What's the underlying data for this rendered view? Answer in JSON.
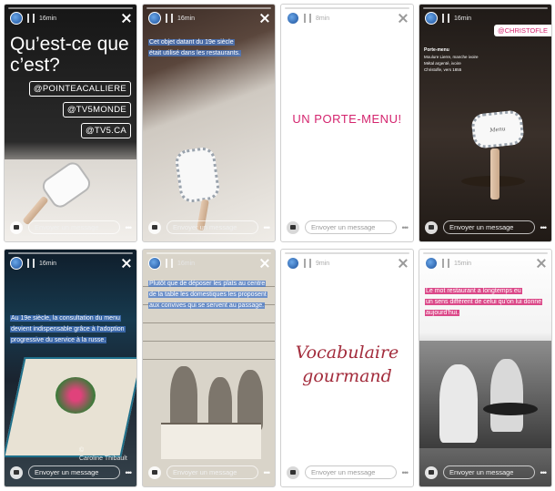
{
  "common": {
    "message_placeholder": "Envoyer un message",
    "time_16": "16min",
    "time_15": "15min"
  },
  "panel1": {
    "question": "Qu’est-ce que c’est?",
    "tags": [
      "@POINTEACALLIERE",
      "@TV5MONDE",
      "@TV5.CA"
    ]
  },
  "panel2": {
    "caption": [
      "Cet objet datant du 19e siècle",
      "était utilisé dans les restaurants."
    ]
  },
  "panel3": {
    "title": "UN PORTE-MENU!",
    "time": "8min"
  },
  "panel4": {
    "mention": "@CHRISTOFLE",
    "info_title": "Porte-menu",
    "info_lines": [
      "Moulure Lierre, manche ivoire",
      "Métal argenté, ivoire",
      "Christofle, vers 1855"
    ],
    "card_text": "Menu"
  },
  "panel5": {
    "caption": [
      "Au 19e siècle, la consultation du menu",
      "devient indispensable grâce à l’adoption",
      "progressive du service à la russe."
    ],
    "credit": [
      "©",
      "Caroline Thibault"
    ]
  },
  "panel6": {
    "caption": [
      "Plutôt que de déposer les plats au centre",
      "de la table les domestiques les proposent",
      "aux convives qui se servent au passage."
    ]
  },
  "panel7": {
    "title": [
      "Vocabulaire",
      "gourmand"
    ],
    "time": "9min"
  },
  "panel8": {
    "caption": [
      "Le mot restaurant a longtemps eu",
      "un sens différent de celui qu’on lui donne",
      "aujourd’hui."
    ]
  },
  "colors": {
    "highlight_blue": "#4678c8",
    "highlight_pink": "#d62a76",
    "accent_pink": "#d4246e",
    "script_red": "#a32c3c"
  }
}
